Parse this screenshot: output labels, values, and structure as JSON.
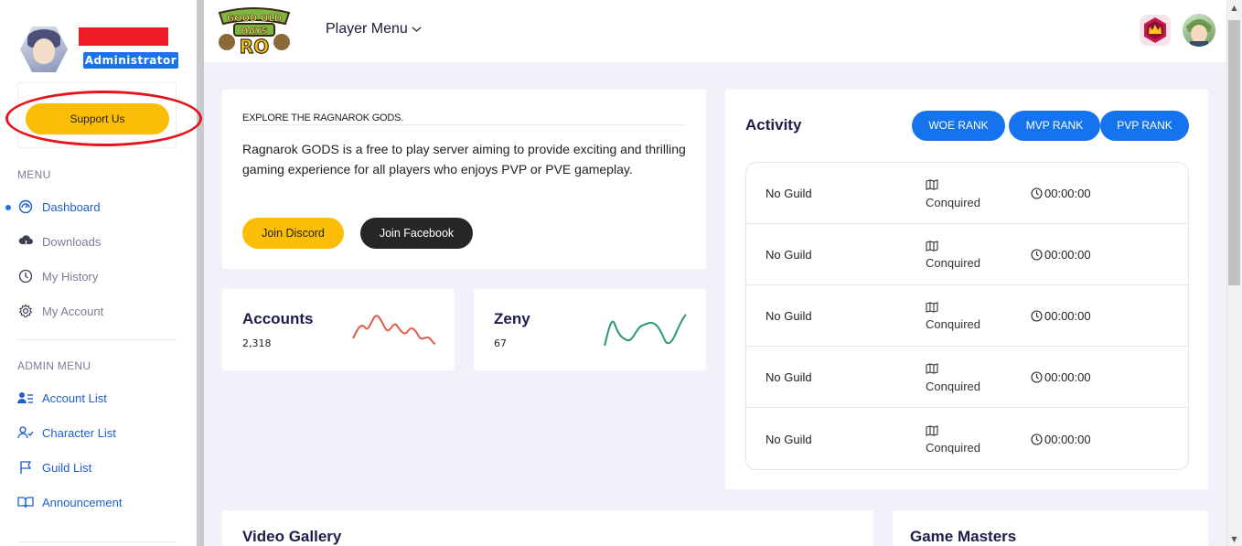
{
  "sidebar": {
    "role": "Administrator",
    "support_label": "Support Us",
    "menu_title": "MENU",
    "menu": [
      {
        "label": "Dashboard",
        "icon": "dashboard-icon"
      },
      {
        "label": "Downloads",
        "icon": "download-cloud-icon"
      },
      {
        "label": "My History",
        "icon": "history-icon"
      },
      {
        "label": "My Account",
        "icon": "gear-icon"
      }
    ],
    "admin_title": "ADMIN MENU",
    "admin_menu": [
      {
        "label": "Account List",
        "icon": "users-list-icon"
      },
      {
        "label": "Character List",
        "icon": "user-check-icon"
      },
      {
        "label": "Guild List",
        "icon": "flag-icon"
      },
      {
        "label": "Announcement",
        "icon": "book-open-icon"
      }
    ]
  },
  "topbar": {
    "logo_text": "GOOD OLD DAYS RO",
    "player_menu": "Player Menu"
  },
  "explore": {
    "title": "EXPLORE THE RAGNAROK GODS.",
    "text": "Ragnarok GODS is a free to play server aiming to provide exciting and thrilling gaming experience for all players who enjoys PVP or PVE gameplay.",
    "discord_label": "Join Discord",
    "facebook_label": "Join Facebook"
  },
  "stats": {
    "accounts": {
      "label": "Accounts",
      "value": "2,318",
      "color": "#e05a4a"
    },
    "zeny": {
      "label": "Zeny",
      "value": "67",
      "color": "#2e9a6a"
    }
  },
  "activity": {
    "title": "Activity",
    "buttons": [
      "WOE RANK",
      "MVP RANK",
      "PVP RANK"
    ],
    "rows": [
      {
        "guild": "No Guild",
        "status": "Conquired",
        "time": "00:00:00"
      },
      {
        "guild": "No Guild",
        "status": "Conquired",
        "time": "00:00:00"
      },
      {
        "guild": "No Guild",
        "status": "Conquired",
        "time": "00:00:00"
      },
      {
        "guild": "No Guild",
        "status": "Conquired",
        "time": "00:00:00"
      },
      {
        "guild": "No Guild",
        "status": "Conquired",
        "time": "00:00:00"
      }
    ]
  },
  "bottom": {
    "video_title": "Video Gallery",
    "gm_title": "Game Masters"
  },
  "colors": {
    "accent_yellow": "#fcbd07",
    "accent_blue": "#1573ee",
    "highlight_red": "#e5141c"
  }
}
